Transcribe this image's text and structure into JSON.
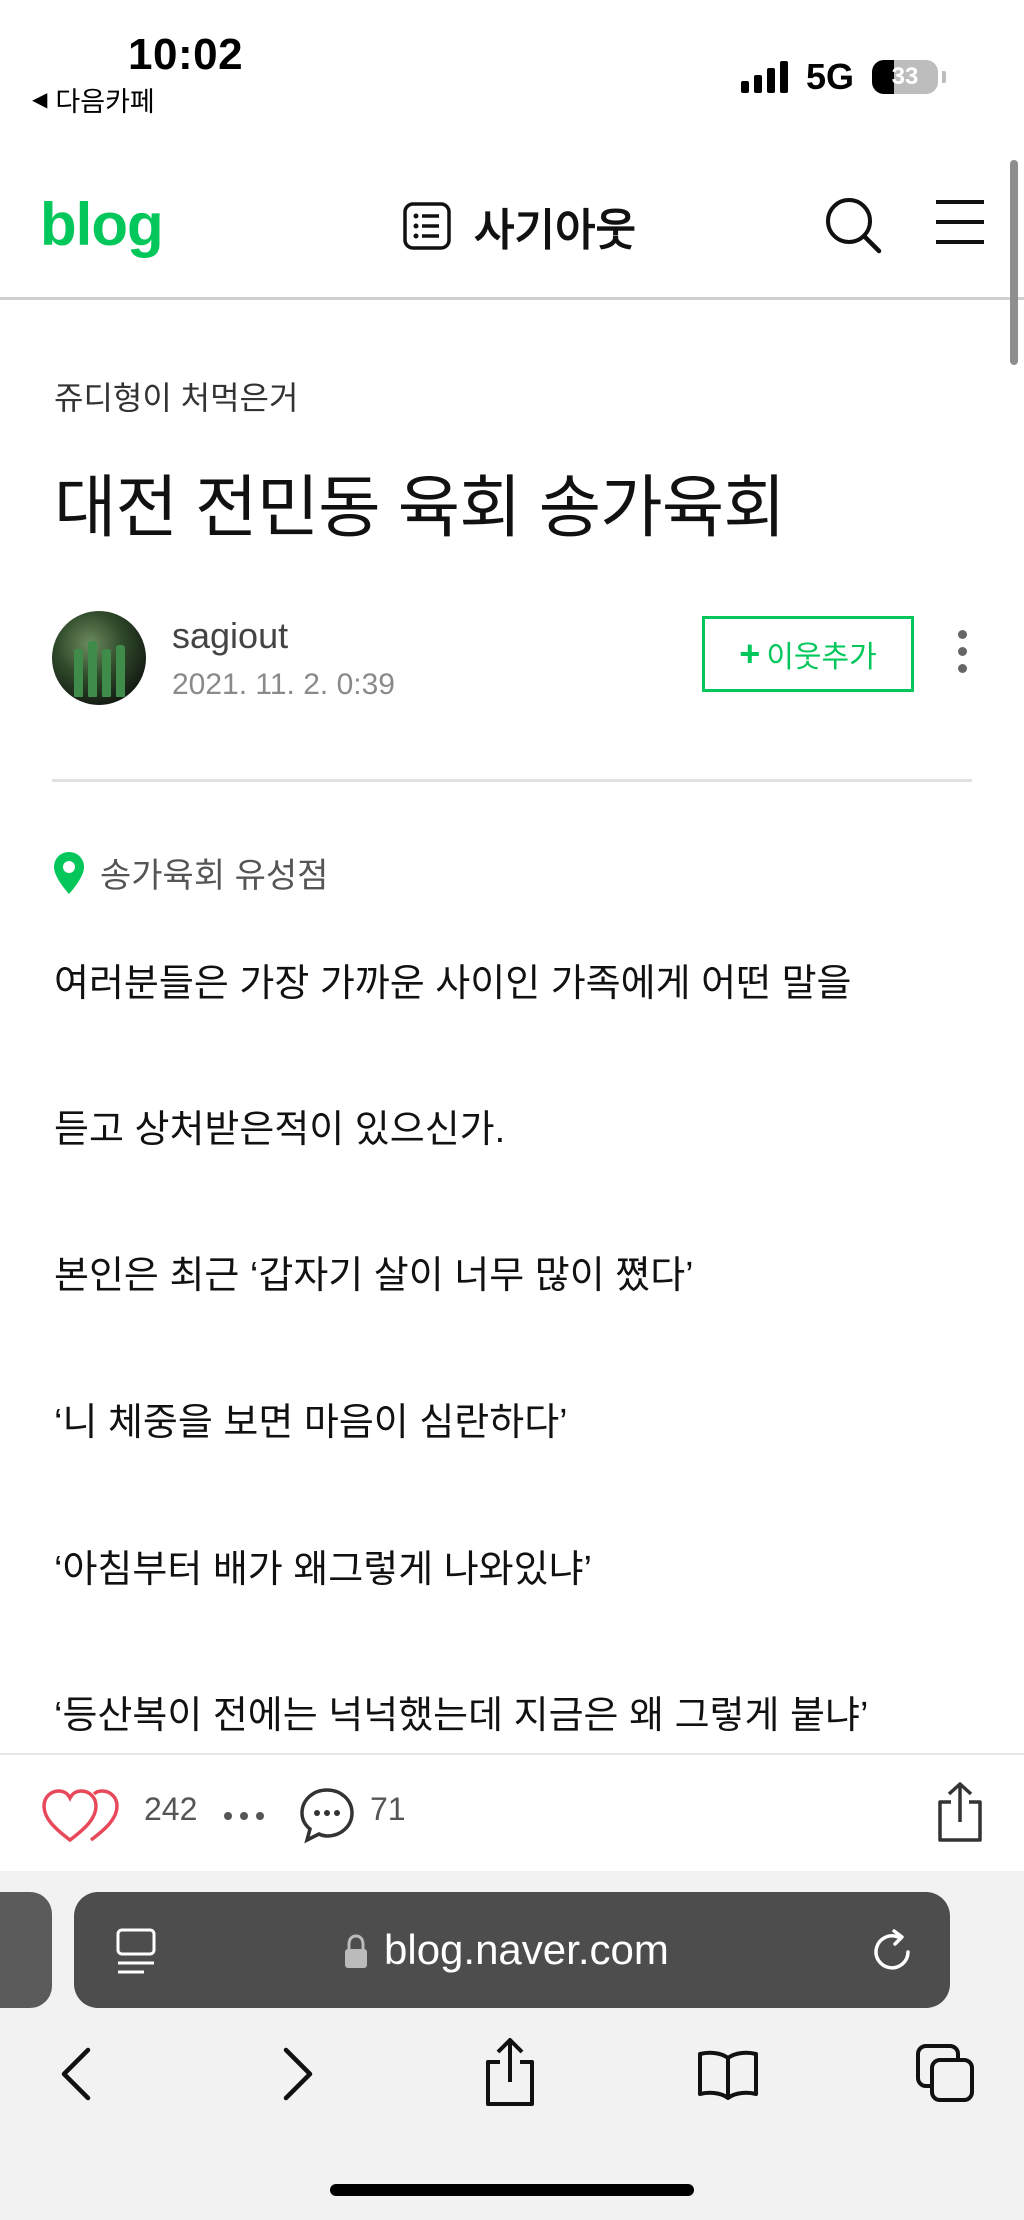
{
  "status_bar": {
    "time": "10:02",
    "back_app": "다음카페",
    "network": "5G",
    "battery_percent": "33",
    "battery_level": 0.33
  },
  "header": {
    "logo": "blog",
    "blog_name": "사기아웃",
    "icons": [
      "list-icon",
      "search-icon",
      "menu-icon"
    ]
  },
  "post": {
    "category": "쥬디형이 처먹은거",
    "title": "대전 전민동 육회 송가육회",
    "author": "sagiout",
    "date": "2021. 11. 2. 0:39",
    "follow_label": "이웃추가",
    "place": "송가육회 유성점",
    "paragraphs": [
      "여러분들은 가장 가까운 사이인 가족에게 어떤 말을",
      "듣고 상처받은적이 있으신가.",
      "본인은 최근 ‘갑자기 살이 너무 많이 쪘다’",
      "‘니 체중을 보면 마음이 심란하다’",
      "‘아침부터 배가 왜그렇게 나와있냐’",
      "‘등산복이 전에는 넉넉했는데 지금은 왜 그렇게 붙냐’"
    ]
  },
  "footer_bar": {
    "likes": "242",
    "comments": "71"
  },
  "browser": {
    "url": "blog.naver.com"
  },
  "colors": {
    "brand_green": "#03c75a",
    "like_red": "#e8495a"
  }
}
